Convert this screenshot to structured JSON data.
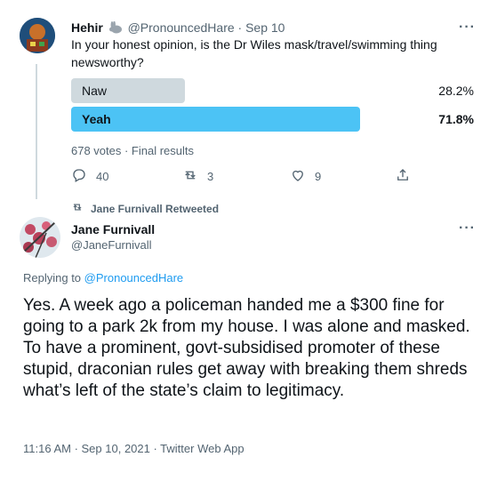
{
  "quoted_tweet": {
    "display_name": "Hehir",
    "handle": "@PronouncedHare",
    "separator": "·",
    "date": "Sep 10",
    "text": "In your honest opinion, is the Dr Wiles mask/travel/swimming thing newsworthy?",
    "poll": {
      "options": [
        {
          "label": "Naw",
          "percent": "28.2%",
          "fraction": 0.282,
          "winner": false
        },
        {
          "label": "Yeah",
          "percent": "71.8%",
          "fraction": 0.718,
          "winner": true
        }
      ],
      "summary": "678 votes · Final results"
    },
    "actions": {
      "replies": "40",
      "retweets": "3",
      "likes": "9"
    }
  },
  "retweet_context": "Jane Furnivall Retweeted",
  "main_tweet": {
    "display_name": "Jane Furnivall",
    "handle": "@JaneFurnivall",
    "replying_prefix": "Replying to",
    "replying_handle": "@PronouncedHare",
    "text": "Yes. A week ago a policeman handed me a $300 fine for going to a park 2k from my house. I was alone and masked. To have a prominent, govt-subsidised promoter of these stupid, draconian rules get away with breaking them shreds what’s left of the state’s claim to legitimacy.",
    "meta": "11:16 AM · Sep 10, 2021 · Twitter Web App"
  },
  "icons": {
    "reply": "reply-icon",
    "retweet": "retweet-icon",
    "like": "heart-icon",
    "share": "share-icon",
    "more": "more-icon",
    "rabbit": "rabbit-emoji"
  },
  "colors": {
    "poll_loser": "#cfd9de",
    "poll_winner": "#4cc3f5",
    "link": "#1d9bf0",
    "muted": "#536471"
  },
  "more_glyph": "···"
}
